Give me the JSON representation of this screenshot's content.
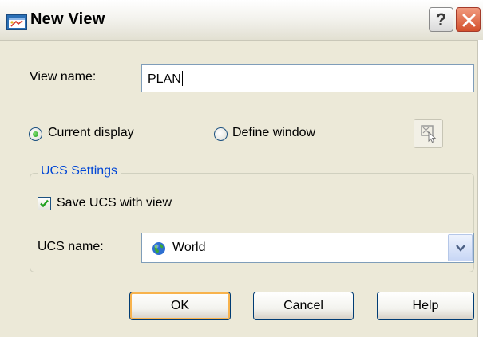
{
  "window": {
    "title": "New View",
    "title_icon": "new-view-icon",
    "help_button_label": "?",
    "close_icon": "close-icon"
  },
  "view_name": {
    "label": "View name:",
    "value": "PLAN"
  },
  "display_options": {
    "current_display_label": "Current display",
    "current_display_selected": true,
    "define_window_label": "Define window",
    "define_window_selected": false,
    "pick_window_icon": "define-window-pick-icon"
  },
  "ucs_settings": {
    "group_title": "UCS Settings",
    "save_ucs_label": "Save UCS with view",
    "save_ucs_checked": true,
    "ucs_name_label": "UCS name:",
    "ucs_name_value": "World",
    "ucs_name_icon": "globe-icon"
  },
  "buttons": {
    "ok": "OK",
    "cancel": "Cancel",
    "help": "Help"
  },
  "colors": {
    "dialog_background": "#ece9d8",
    "group_title_color": "#0046d5",
    "close_button": "#d4502c",
    "check_green": "#21a121"
  }
}
